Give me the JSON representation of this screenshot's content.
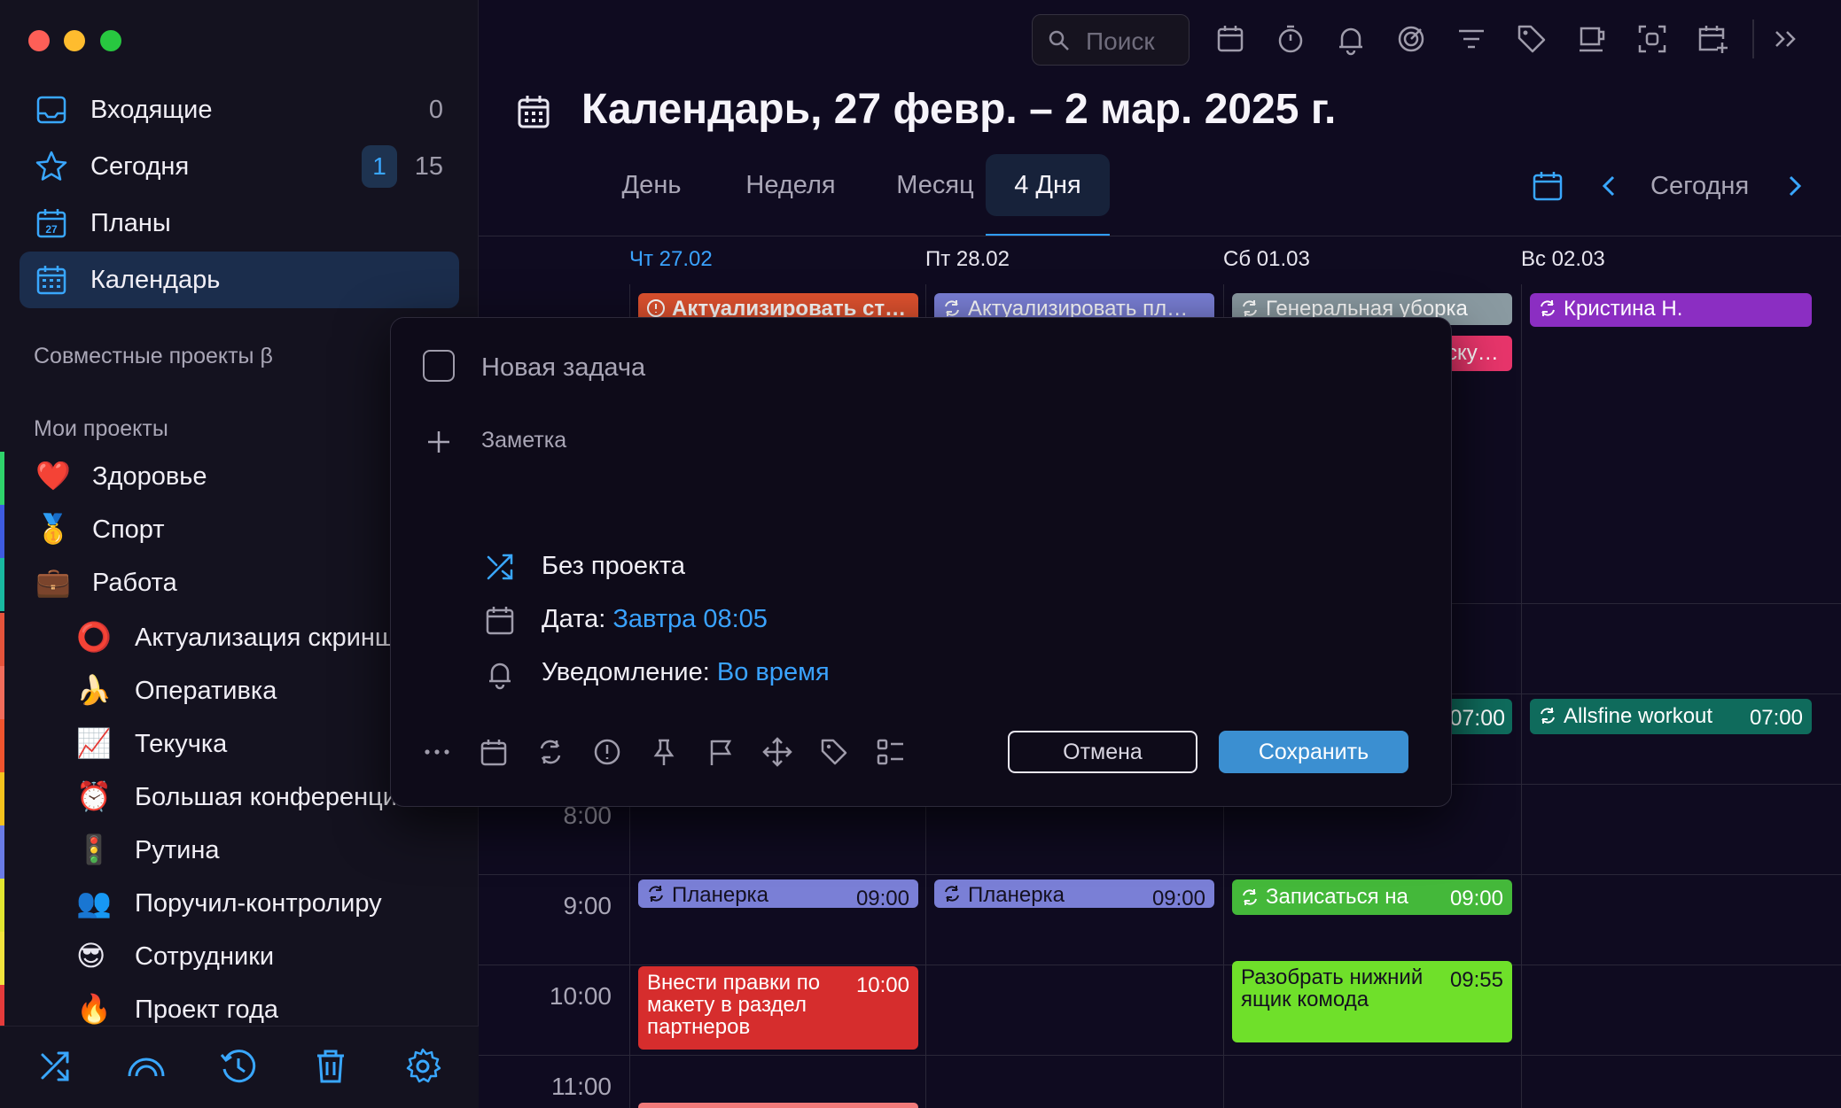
{
  "window": {
    "controls": [
      "close",
      "minimize",
      "zoom"
    ]
  },
  "sidebar": {
    "nav": [
      {
        "label": "Входящие",
        "count": "0",
        "icon": "inbox-icon"
      },
      {
        "label": "Сегодня",
        "badge": "1",
        "count": "15",
        "icon": "star-icon"
      },
      {
        "label": "Планы",
        "icon": "calendar-27-icon"
      },
      {
        "label": "Календарь",
        "icon": "calendar-grid-icon",
        "active": true
      }
    ],
    "shared_title": "Совместные проекты β",
    "my_title": "Мои проекты",
    "projects": [
      {
        "emoji": "❤️",
        "label": "Здоровье",
        "color": "#2fd46b"
      },
      {
        "emoji": "🥇",
        "label": "Спорт",
        "color": "#3e5be0"
      },
      {
        "emoji": "💼",
        "label": "Работа",
        "color": "#19b9a0"
      },
      {
        "emoji": "⭕",
        "label": "Актуализация скринш",
        "color": "#e5533b"
      },
      {
        "emoji": "🍌",
        "label": "Оперативка",
        "color": "#f26c5b"
      },
      {
        "emoji": "📈",
        "label": "Текучка",
        "color": "#f0542e"
      },
      {
        "emoji": "⏰",
        "label": "Большая конференци…",
        "color": "#f4c21d"
      },
      {
        "emoji": "🚦",
        "label": "Рутина",
        "color": "#6a7be6"
      },
      {
        "emoji": "👥",
        "label": "Поручил-контролиру",
        "color": "#e2e630"
      },
      {
        "emoji": "😎",
        "label": "Сотрудники",
        "color": "#f3e43d"
      },
      {
        "emoji": "🔥",
        "label": "Проект года",
        "color": "#e53b3b"
      }
    ],
    "bottom_icons": [
      "shuffle-icon",
      "arc-icon",
      "history-icon",
      "trash-icon",
      "settings-icon"
    ]
  },
  "toolbar": {
    "search_placeholder": "Поиск",
    "icons": [
      "calendar-icon",
      "timer-icon",
      "bell-icon",
      "target-icon",
      "filter-icon",
      "tag-icon",
      "coffee-icon",
      "focus-icon",
      "add-calendar-icon",
      "expand-icon"
    ]
  },
  "header": {
    "title": "Календарь, 27 февр. – 2 мар. 2025 г.",
    "tabs": [
      "День",
      "Неделя",
      "Месяц",
      "4 Дня"
    ],
    "active_tab": "4 Дня",
    "today_label": "Сегодня"
  },
  "calendar": {
    "days": [
      {
        "label": "Чт 27.02",
        "today": true
      },
      {
        "label": "Пт 28.02"
      },
      {
        "label": "Сб 01.03"
      },
      {
        "label": "Вс 02.03"
      }
    ],
    "hours": [
      "8:00",
      "9:00",
      "10:00",
      "11:00"
    ],
    "events": [
      {
        "day": 0,
        "title": "Актуализировать ст…",
        "time": "",
        "color": "#e0522f",
        "icon": "alert-icon"
      },
      {
        "day": 1,
        "title": "Актуализировать пл…",
        "time": "",
        "color": "#7a7fd6",
        "icon": "repeat-icon"
      },
      {
        "day": 2,
        "title": "Генеральная уборка",
        "time": "",
        "color": "#8a9aa1",
        "icon": "repeat-icon"
      },
      {
        "day": 2,
        "title": "…ску…",
        "time": "",
        "color": "#e8356b",
        "icon": ""
      },
      {
        "day": 3,
        "title": "Кристина Н.",
        "time": "",
        "color": "#8b2ec2",
        "icon": "repeat-icon"
      },
      {
        "day": 2,
        "title": "",
        "time": "07:00",
        "color": "#0f6b5c",
        "icon": ""
      },
      {
        "day": 3,
        "title": "Allsfine workout",
        "time": "07:00",
        "color": "#0f6b5c",
        "icon": "repeat-icon"
      },
      {
        "day": 0,
        "title": "Планерка",
        "time": "09:00",
        "color": "#7a7fd6",
        "icon": "repeat-icon"
      },
      {
        "day": 1,
        "title": "Планерка",
        "time": "09:00",
        "color": "#7a7fd6",
        "icon": "repeat-icon"
      },
      {
        "day": 2,
        "title": "Записаться на",
        "time": "09:00",
        "color": "#44b83a",
        "icon": "repeat-icon"
      },
      {
        "day": 0,
        "title": "Внести правки по макету в раздел партнеров",
        "time": "10:00",
        "color": "#d62d2d",
        "icon": ""
      },
      {
        "day": 2,
        "title": "Разобрать нижний ящик комода",
        "time": "09:55",
        "color": "#6fe02a",
        "icon": ""
      }
    ]
  },
  "popup": {
    "title_placeholder": "Новая задача",
    "note_label": "Заметка",
    "project_label": "Без проекта",
    "date_label": "Дата:",
    "date_value": "Завтра 08:05",
    "reminder_label": "Уведомление:",
    "reminder_value": "Во время",
    "tool_icons": [
      "more-icon",
      "calendar-icon",
      "repeat-icon",
      "priority-icon",
      "pin-icon",
      "flag-icon",
      "move-icon",
      "tag-icon",
      "checklist-icon"
    ],
    "cancel_label": "Отмена",
    "save_label": "Сохранить",
    "accent": "#3aa3ff"
  }
}
